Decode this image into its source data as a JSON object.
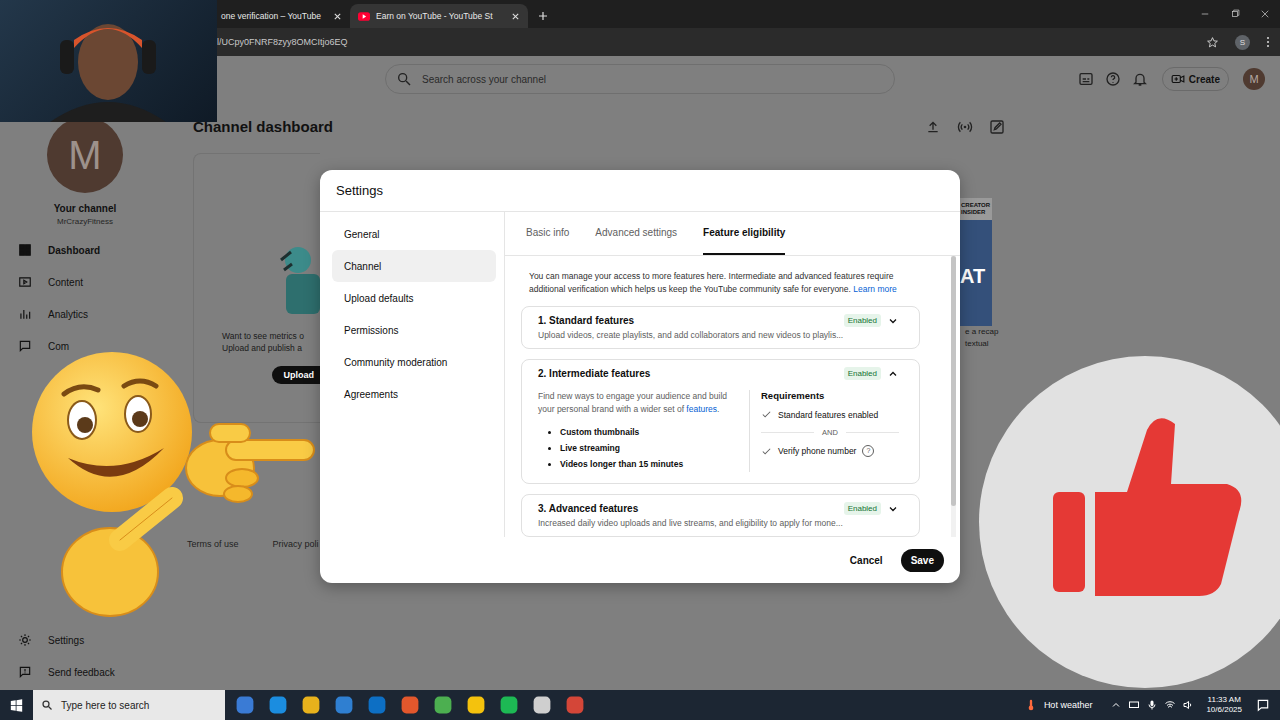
{
  "browser": {
    "tabs": [
      {
        "label": "one verification – YouTube",
        "selected": false
      },
      {
        "label": "Earn on YouTube - YouTube St",
        "selected": true
      }
    ],
    "address": "l/UCpy0FNRF8zyy8OMCItjo6EQ",
    "profile": "S"
  },
  "header": {
    "search_placeholder": "Search across your channel",
    "create": "Create",
    "avatar": "M"
  },
  "sidebar": {
    "avatar": "M",
    "title": "Your channel",
    "handle": "MrCrazyFitness",
    "items": [
      {
        "label": "Dashboard",
        "selected": true
      },
      {
        "label": "Content",
        "selected": false
      },
      {
        "label": "Analytics",
        "selected": false
      },
      {
        "label": "Com",
        "selected": false
      }
    ],
    "bottom_items": [
      {
        "label": "Settings",
        "selected": false
      },
      {
        "label": "Send feedback",
        "selected": false
      }
    ]
  },
  "dashboard": {
    "title": "Channel dashboard",
    "card_lines": [
      "Want to see metrics o",
      "Upload and publish a"
    ],
    "upload_button": "Upload",
    "promo": {
      "label": [
        "CREATOR",
        "INSIDER"
      ],
      "big": "AT",
      "lines": [
        "e a recap",
        "textual"
      ]
    },
    "footer_links": [
      "Terms of use",
      "Privacy poli"
    ]
  },
  "modal": {
    "title": "Settings",
    "nav": [
      {
        "label": "General",
        "selected": false
      },
      {
        "label": "Channel",
        "selected": true
      },
      {
        "label": "Upload defaults",
        "selected": false
      },
      {
        "label": "Permissions",
        "selected": false
      },
      {
        "label": "Community moderation",
        "selected": false
      },
      {
        "label": "Agreements",
        "selected": false
      }
    ],
    "tabs": [
      {
        "label": "Basic info",
        "selected": false
      },
      {
        "label": "Advanced settings",
        "selected": false
      },
      {
        "label": "Feature eligibility",
        "selected": true
      }
    ],
    "intro": "You can manage your access to more features here. Intermediate and advanced features require additional verification which helps us keep the YouTube community safe for everyone.",
    "learn_more": "Learn more",
    "features": [
      {
        "title": "1. Standard features",
        "summary": "Upload videos, create playlists, and add collaborators and new videos to playlis...",
        "status": "Enabled",
        "expanded": false
      },
      {
        "title": "2. Intermediate features",
        "status": "Enabled",
        "expanded": true,
        "description": "Find new ways to engage your audience and build your personal brand with a wider set of",
        "link": "features",
        "link_end": ".",
        "bullets": [
          "Custom thumbnails",
          "Live streaming",
          "Videos longer than 15 minutes"
        ],
        "requirements_title": "Requirements",
        "requirements": [
          {
            "label": "Standard features enabled",
            "met": true,
            "help": ""
          },
          {
            "label": "Verify phone number",
            "met": true,
            "help": "?"
          }
        ],
        "joiner": "AND"
      },
      {
        "title": "3. Advanced features",
        "summary": "Increased daily video uploads and live streams, and eligibility to apply for mone...",
        "status": "Enabled",
        "expanded": false
      }
    ],
    "cancel": "Cancel",
    "save": "Save"
  },
  "taskbar": {
    "search_placeholder": "Type here to search",
    "weather": "Hot weather",
    "time": "11:33 AM",
    "date": "10/6/2025"
  }
}
